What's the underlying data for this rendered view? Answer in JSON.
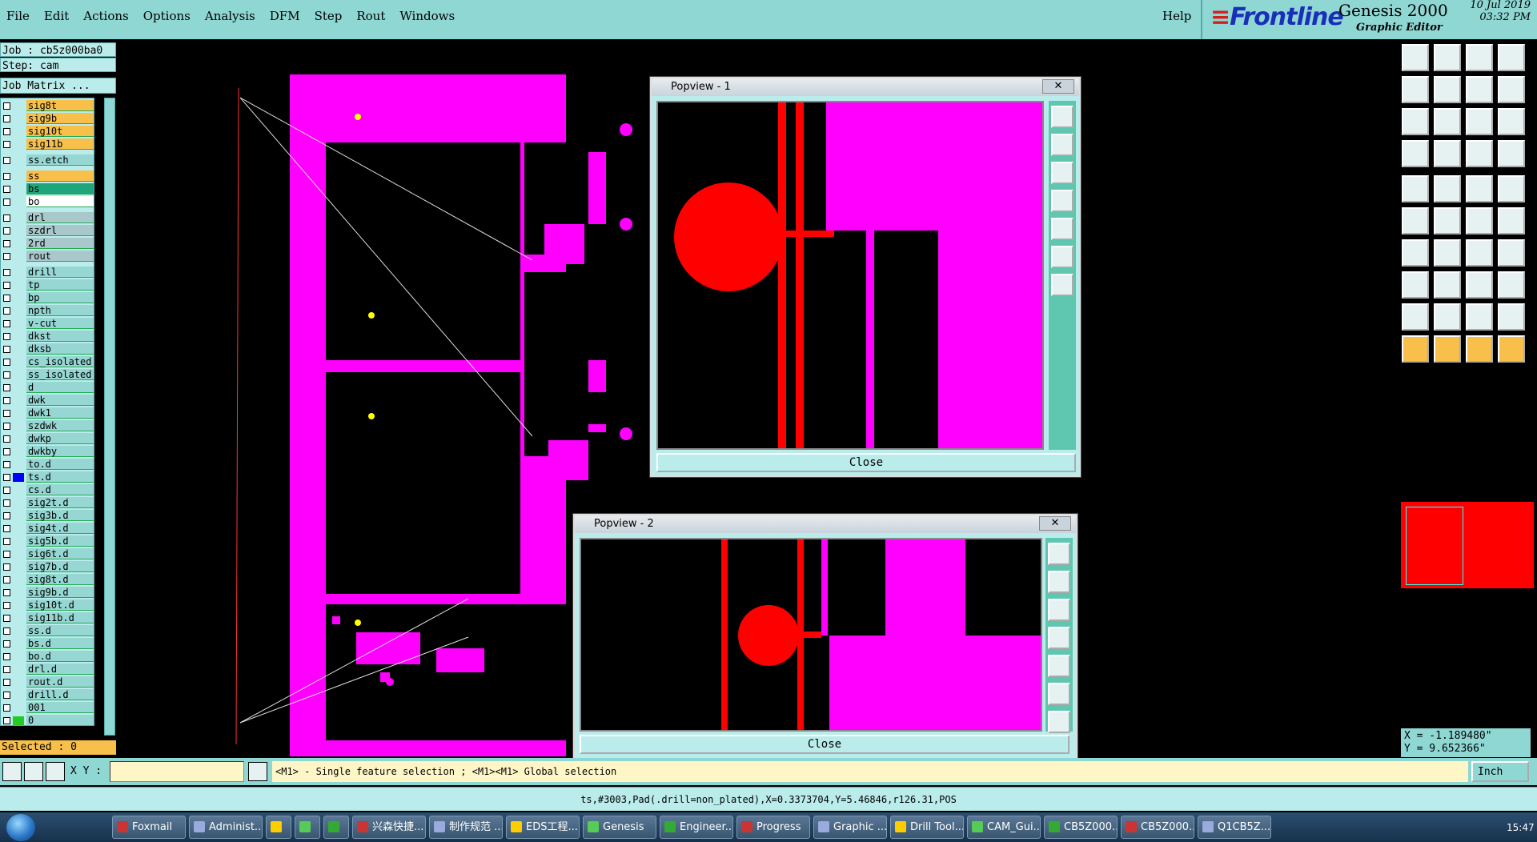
{
  "menu": [
    "File",
    "Edit",
    "Actions",
    "Options",
    "Analysis",
    "DFM",
    "Step",
    "Rout",
    "Windows"
  ],
  "help": "Help",
  "brand": {
    "logo": "Frontline",
    "product": "Genesis 2000",
    "subtitle": "Graphic Editor",
    "date": "10 Jul 2019",
    "time": "03:32 PM"
  },
  "job": "Job : cb5z000ba0",
  "step": "Step: cam",
  "job_matrix": "Job Matrix ...",
  "layers": [
    "sig8t",
    "sig9b",
    "sig10t",
    "sig11b",
    "ss.etch",
    "ss",
    "bs",
    "bo",
    "drl",
    "szdrl",
    "2rd",
    "rout",
    "drill",
    "tp",
    "bp",
    "npth",
    "v-cut",
    "dkst",
    "dksb",
    "cs_isolated",
    "ss_isolated",
    "d",
    "dwk",
    "dwk1",
    "szdwk",
    "dwkp",
    "dwkby",
    "to.d",
    "ts.d",
    "cs.d",
    "sig2t.d",
    "sig3b.d",
    "sig4t.d",
    "sig5b.d",
    "sig6t.d",
    "sig7b.d",
    "sig8t.d",
    "sig9b.d",
    "sig10t.d",
    "sig11b.d",
    "ss.d",
    "bs.d",
    "bo.d",
    "drl.d",
    "rout.d",
    "drill.d",
    "001",
    "0"
  ],
  "selected": "Selected : 0",
  "popview1": {
    "title": "Popview - 1",
    "close": "Close"
  },
  "popview2": {
    "title": "Popview - 2",
    "close": "Close"
  },
  "coords": {
    "x": "X = -1.189480\"",
    "y": "Y = 9.652366\""
  },
  "cmd": {
    "xy_label": "X Y :",
    "hint": "<M1> - Single feature selection ; <M1><M1> Global selection",
    "unit": "Inch"
  },
  "status": "ts,#3003,Pad(.drill=non_plated),X=0.3373704,Y=5.46846,r126.31,POS",
  "taskbar": [
    "Foxmail",
    "Administ...",
    "",
    "",
    "",
    "兴森快捷...",
    "制作规范 ...",
    "EDS工程...",
    "Genesis",
    "Engineer...",
    "Progress",
    "Graphic ...",
    "Drill Tool...",
    "CAM_Gui...",
    "CB5Z000...",
    "CB5Z000...",
    "Q1CB5Z..."
  ],
  "clock": "15:47"
}
